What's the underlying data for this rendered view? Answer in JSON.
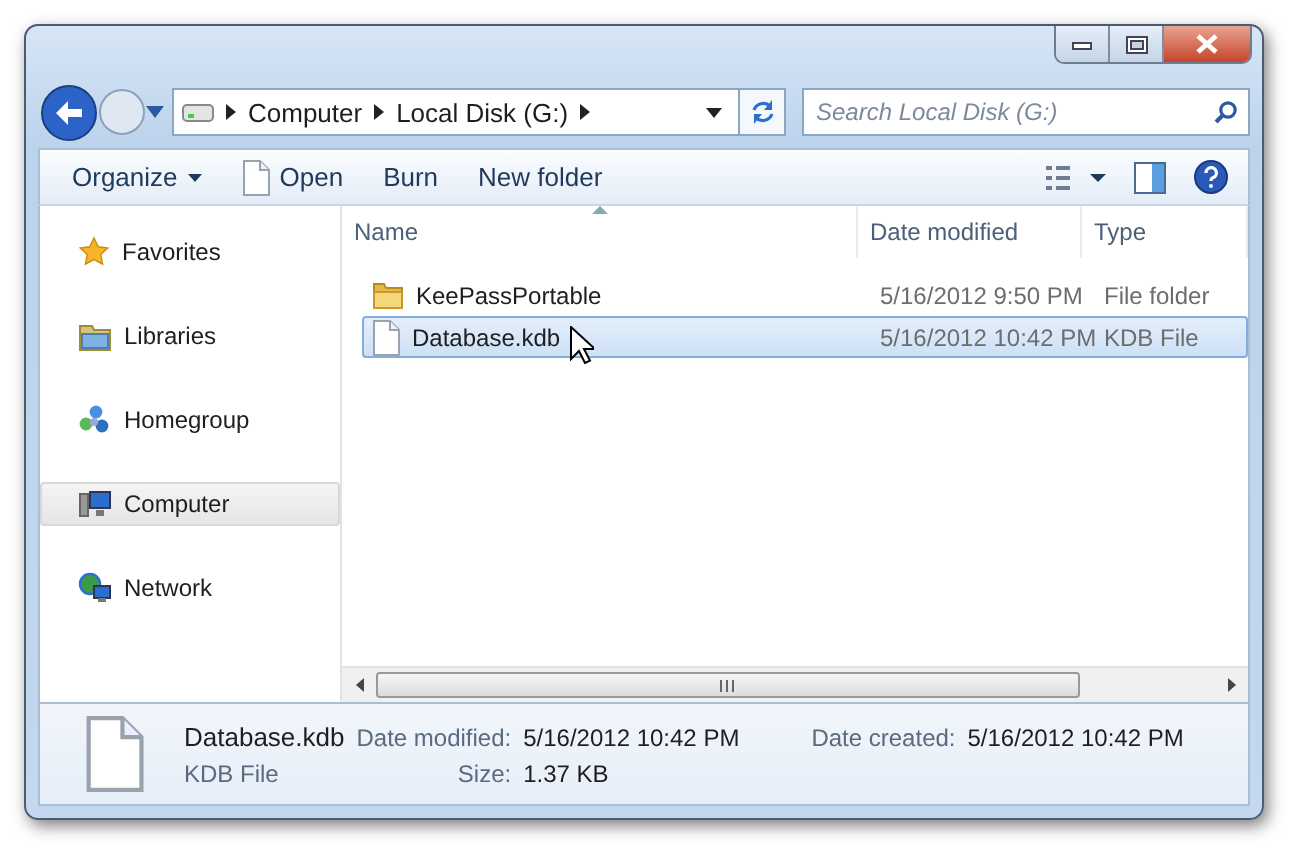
{
  "address": {
    "crumbs": [
      "Computer",
      "Local Disk (G:)"
    ]
  },
  "search": {
    "placeholder": "Search Local Disk (G:)"
  },
  "toolbar": {
    "items": [
      {
        "label": "Organize",
        "kind": "menu"
      },
      {
        "label": "Open",
        "kind": "file"
      },
      {
        "label": "Burn",
        "kind": "plain"
      },
      {
        "label": "New folder",
        "kind": "plain"
      }
    ]
  },
  "sidebar": {
    "items": [
      {
        "label": "Favorites",
        "kind": "favorites",
        "selected": false
      },
      {
        "label": "Libraries",
        "kind": "libraries",
        "selected": false
      },
      {
        "label": "Homegroup",
        "kind": "homegroup",
        "selected": false
      },
      {
        "label": "Computer",
        "kind": "computer",
        "selected": true
      },
      {
        "label": "Network",
        "kind": "network",
        "selected": false
      }
    ]
  },
  "table": {
    "columns": [
      {
        "label": "Name",
        "sorted": true
      },
      {
        "label": "Date modified",
        "sorted": false
      },
      {
        "label": "Type",
        "sorted": false
      }
    ],
    "rows": [
      {
        "name": "KeePassPortable",
        "date": "5/16/2012 9:50 PM",
        "type": "File folder",
        "kind": "folder",
        "selected": false
      },
      {
        "name": "Database.kdb",
        "date": "5/16/2012 10:42 PM",
        "type": "KDB File",
        "kind": "file",
        "selected": true
      }
    ]
  },
  "details": {
    "name": "Database.kdb",
    "type": "KDB File",
    "fields": [
      {
        "label": "Date modified:",
        "value": "5/16/2012 10:42 PM"
      },
      {
        "label": "Date created:",
        "value": "5/16/2012 10:42 PM"
      },
      {
        "label": "Size:",
        "value": "1.37 KB"
      }
    ]
  }
}
